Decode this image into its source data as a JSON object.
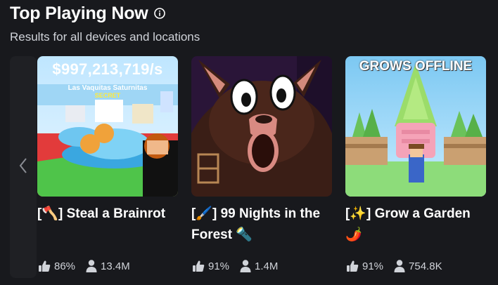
{
  "section": {
    "title": "Top Playing Now",
    "subtitle": "Results for all devices and locations",
    "info_icon": "info-circle-icon",
    "scroll_icon": "chevron-left-icon"
  },
  "games": [
    {
      "name": "[🪓] Steal a Brainrot",
      "thumbnail_banner": "$997,213,719/s",
      "thumbnail_caption": "Las Vaquitas Saturnitas",
      "thumbnail_badge": "SECRET",
      "like_ratio": "86%",
      "players": "13.4M"
    },
    {
      "name": "[🖌️] 99 Nights in the Forest 🔦",
      "like_ratio": "91%",
      "players": "1.4M"
    },
    {
      "name": "[✨] Grow a Garden 🌶️",
      "thumbnail_banner": "GROWS OFFLINE",
      "like_ratio": "91%",
      "players": "754.8K"
    }
  ],
  "icons": {
    "like": "thumbs-up-icon",
    "players": "person-icon"
  },
  "colors": {
    "background": "#18191d",
    "text_primary": "#ffffff",
    "text_secondary": "#d0d3d9"
  }
}
